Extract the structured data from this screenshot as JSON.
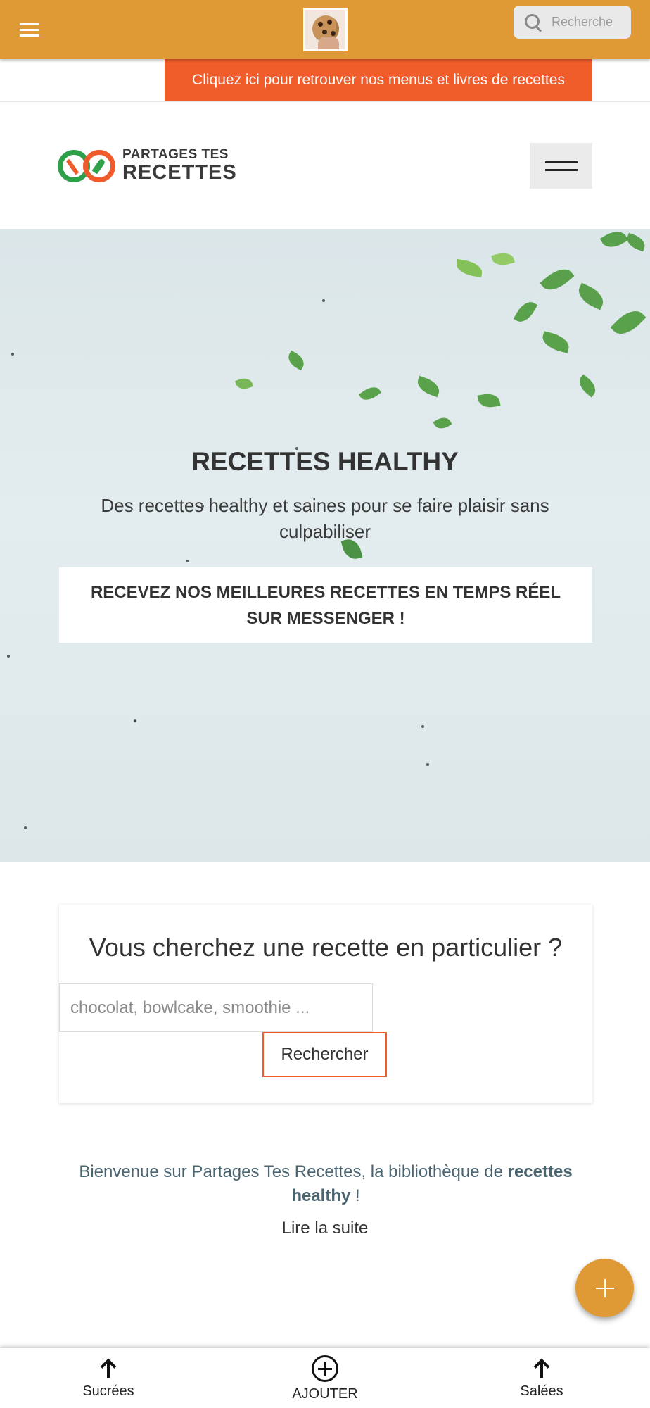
{
  "appbar": {
    "search_placeholder": "Recherche",
    "bg_color": "#e09a35"
  },
  "promo": {
    "label": "Cliquez ici pour retrouver nos menus et livres de recettes",
    "color": "#f15d2a"
  },
  "header": {
    "logo_line1": "PARTAGES TES",
    "logo_line2": "RECETTES"
  },
  "hero": {
    "title": "RECETTES HEALTHY",
    "subtitle": "Des recettes healthy et saines pour se faire plaisir sans culpabiliser",
    "messenger_button": "RECEVEZ NOS MEILLEURES RECETTES EN TEMPS RÉEL SUR MESSENGER !"
  },
  "search": {
    "heading": "Vous cherchez une recette en particulier ?",
    "placeholder": "chocolat, bowlcake, smoothie ...",
    "button": "Rechercher"
  },
  "intro": {
    "text_before": "Bienvenue sur Partages Tes Recettes, la bibliothèque de ",
    "text_bold": "recettes healthy",
    "text_after": " !",
    "read_more": "Lire la suite"
  },
  "bottom_nav": {
    "items": [
      {
        "label": "Sucrées",
        "icon": "arrow-up-icon"
      },
      {
        "label": "AJOUTER",
        "icon": "add-circle-icon"
      },
      {
        "label": "Salées",
        "icon": "arrow-up-icon"
      }
    ]
  }
}
